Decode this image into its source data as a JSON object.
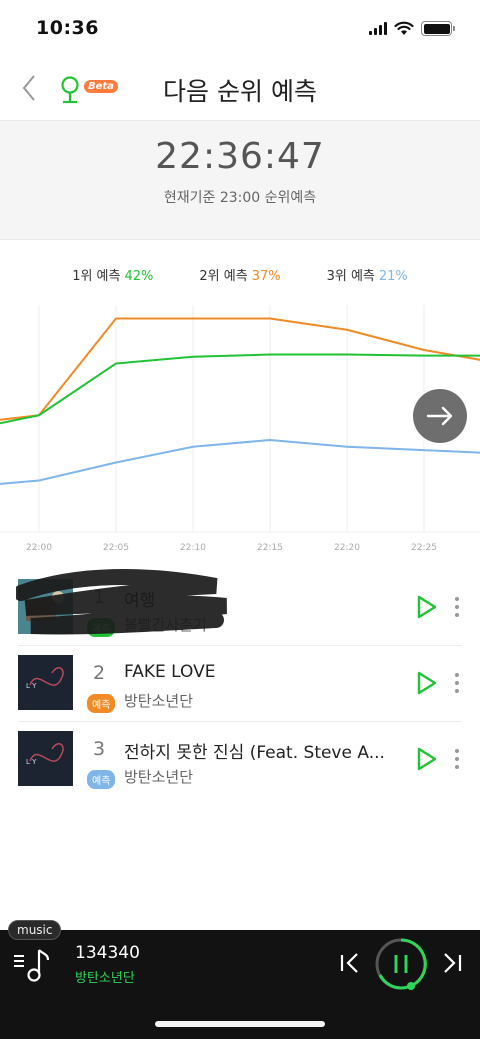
{
  "status_bar": {
    "time": "10:36"
  },
  "header": {
    "title": "다음 순위 예측",
    "beta_label": "Beta"
  },
  "timer": {
    "clock": "22:36:47",
    "subtitle": "현재기준 23:00 순위예측"
  },
  "legend": [
    {
      "label": "1위 예측",
      "percent": "42%",
      "color": "#21c236"
    },
    {
      "label": "2위 예측",
      "percent": "37%",
      "color": "#f08a24"
    },
    {
      "label": "3위 예측",
      "percent": "21%",
      "color": "#7fb5e8"
    }
  ],
  "chart_data": {
    "type": "line",
    "x": [
      "21:55",
      "22:00",
      "22:05",
      "22:10",
      "22:15",
      "22:20",
      "22:25",
      "22:30"
    ],
    "tick_labels": [
      "22:00",
      "22:05",
      "22:10",
      "22:15",
      "22:20",
      "22:25"
    ],
    "series": [
      {
        "name": "1위 예측",
        "color": "#21c236",
        "values": [
          44,
          51,
          74,
          77,
          78,
          78,
          77.5,
          77.5
        ]
      },
      {
        "name": "2위 예측",
        "color": "#f08a24",
        "values": [
          47,
          51,
          94,
          94,
          94,
          89,
          80,
          74
        ]
      },
      {
        "name": "3위 예측",
        "color": "#7fb5e8",
        "values": [
          19,
          22,
          30,
          37,
          40,
          37,
          35.5,
          34
        ]
      }
    ],
    "ylim": [
      0,
      100
    ],
    "grid": "vertical",
    "legend_position": "top"
  },
  "songs": [
    {
      "rank": "1",
      "title": "여행",
      "artist": "볼빨간사춘기",
      "badge": "예측",
      "badge_color": "#21c236"
    },
    {
      "rank": "2",
      "title": "FAKE LOVE",
      "artist": "방탄소년단",
      "badge": "예측",
      "badge_color": "#f08a24"
    },
    {
      "rank": "3",
      "title": "전하지 못한 진심 (Feat. Steve A...",
      "artist": "방탄소년단",
      "badge": "예측",
      "badge_color": "#7fb5e8"
    }
  ],
  "player": {
    "tag": "music",
    "title": "134340",
    "artist": "방탄소년단",
    "accent": "#2fd45a"
  }
}
